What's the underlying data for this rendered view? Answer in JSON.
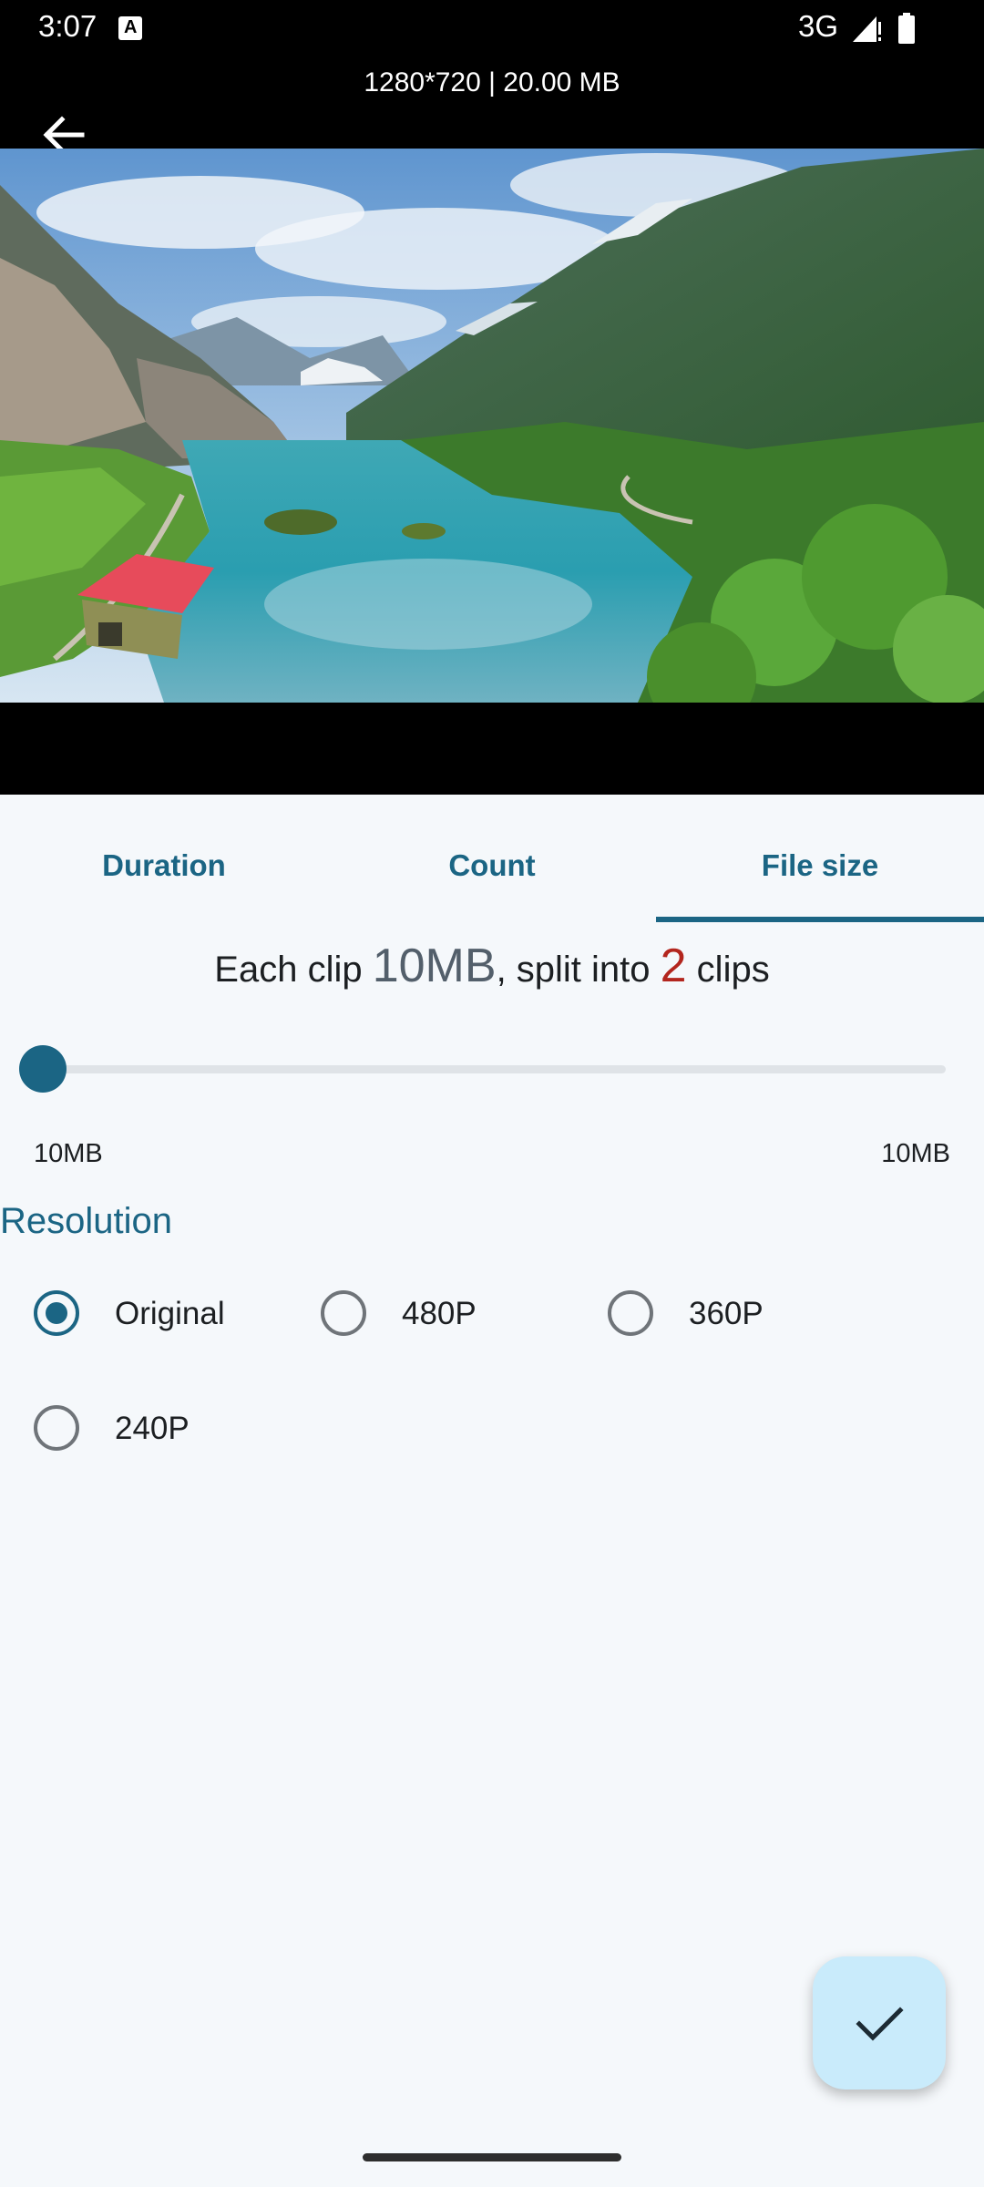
{
  "status_bar": {
    "time": "3:07",
    "a_icon_letter": "A",
    "network": "3G",
    "icons": [
      "a-icon",
      "signal-icon",
      "battery-icon"
    ]
  },
  "video": {
    "info": "1280*720 | 20.00 MB"
  },
  "tabs": [
    {
      "label": "Duration",
      "selected": false
    },
    {
      "label": "Count",
      "selected": false
    },
    {
      "label": "File size",
      "selected": true
    }
  ],
  "summary": {
    "prefix": "Each clip ",
    "size": "10MB",
    "middle": ", split into ",
    "count": "2",
    "suffix": " clips"
  },
  "slider": {
    "min_label": "10MB",
    "max_label": "10MB",
    "value_fraction": 0
  },
  "resolution": {
    "title": "Resolution",
    "options": [
      {
        "label": "Original",
        "checked": true
      },
      {
        "label": "480P",
        "checked": false
      },
      {
        "label": "360P",
        "checked": false
      },
      {
        "label": "240P",
        "checked": false
      }
    ]
  },
  "colors": {
    "accent": "#1b6584",
    "count_red": "#b3261e",
    "fab_bg": "#c9ebfb",
    "background": "#f5f8fb"
  },
  "icons": {
    "back": "arrow-left-icon",
    "confirm": "check-icon"
  }
}
